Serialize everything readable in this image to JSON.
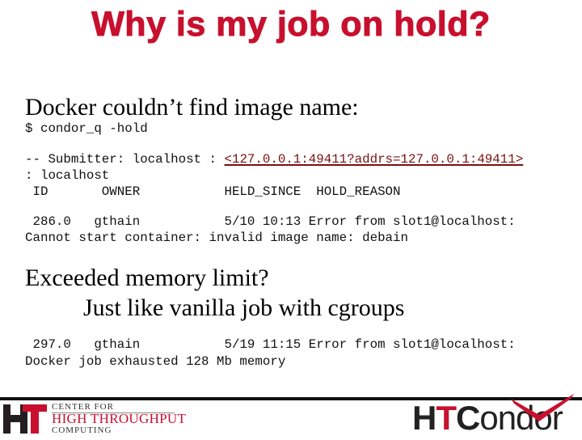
{
  "slide": {
    "title": "Why is my job on hold?",
    "section1": {
      "heading": "Docker couldn’t find image name:",
      "command": "$ condor_q -hold",
      "submitter_prefix": "-- Submitter: localhost : ",
      "submitter_link": "<127.0.0.1:49411?addrs=127.0.0.1:49411>",
      "submitter_line2": ": localhost",
      "columns_header": " ID       OWNER           HELD_SINCE  HOLD_REASON",
      "job_line1": " 286.0   gthain           5/10 10:13 Error from slot1@localhost:",
      "job_line2": "Cannot start container: invalid image name: debain"
    },
    "section2": {
      "heading": "Exceeded memory limit?",
      "subheading": "Just like vanilla job with cgroups",
      "job_line1": " 297.0   gthain           5/19 11:15 Error from slot1@localhost:",
      "job_line2": "Docker job exhausted 128 Mb memory"
    }
  },
  "footer": {
    "left_logo": {
      "mark_h": "H",
      "mark_t": "T",
      "line1": "CENTER FOR",
      "line2": "HIGH THROUGHPUT",
      "line3": "COMPUTING"
    },
    "right_logo": {
      "h": "H",
      "t": "T",
      "c": "C",
      "rest": "ondor"
    }
  },
  "colors": {
    "accent_red": "#c8102e",
    "link_maroon": "#7a1010",
    "text": "#000000"
  }
}
